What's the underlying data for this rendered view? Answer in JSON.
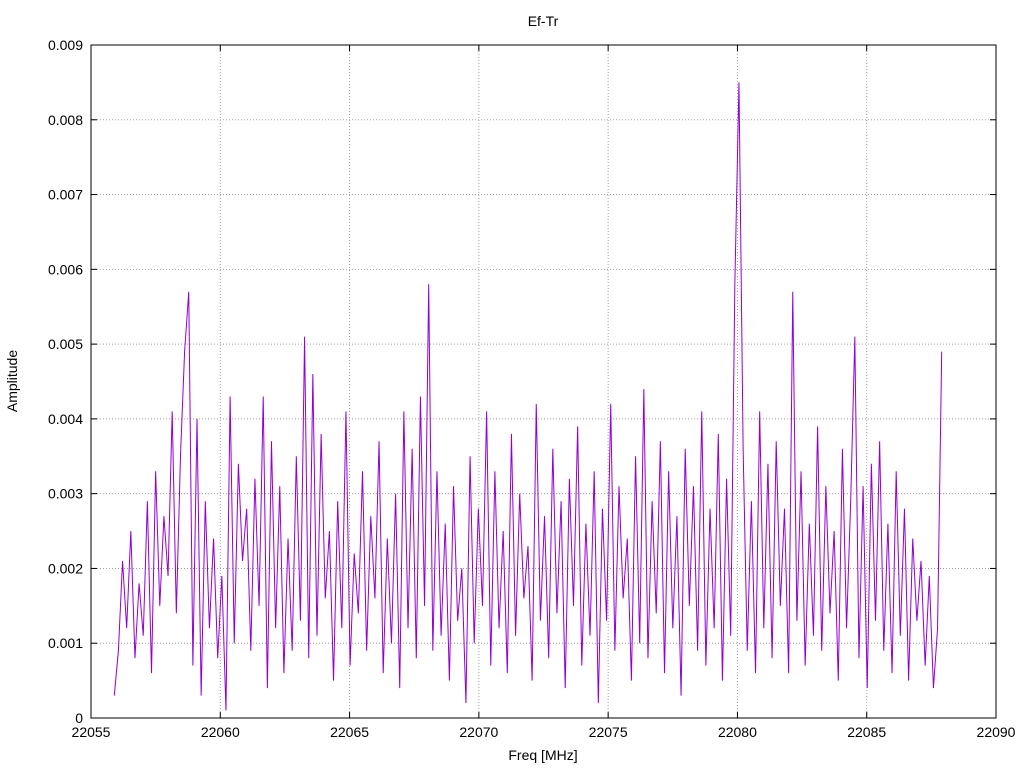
{
  "chart_data": {
    "type": "line",
    "title": "Ef-Tr",
    "xlabel": "Freq [MHz]",
    "ylabel": "Amplitude",
    "xlim": [
      22055,
      22090
    ],
    "ylim": [
      0,
      0.009
    ],
    "xticks": [
      "22055",
      "22060",
      "22065",
      "22070",
      "22075",
      "22080",
      "22085",
      "22090"
    ],
    "yticks": [
      "0",
      "0.001",
      "0.002",
      "0.003",
      "0.004",
      "0.005",
      "0.006",
      "0.007",
      "0.008",
      "0.009"
    ],
    "grid": true,
    "legend": "none",
    "series": [
      {
        "name": "Ef-Tr",
        "color": "#9400d3",
        "x_start": 22055.9,
        "x_step": 0.16,
        "values": [
          0.0003,
          0.0009,
          0.0021,
          0.0012,
          0.0025,
          0.0008,
          0.0018,
          0.0011,
          0.0029,
          0.0006,
          0.0033,
          0.0015,
          0.0027,
          0.0019,
          0.0041,
          0.0014,
          0.0035,
          0.0049,
          0.0057,
          0.0007,
          0.004,
          0.0003,
          0.0029,
          0.0012,
          0.0024,
          0.0008,
          0.0019,
          0.0001,
          0.0043,
          0.001,
          0.0034,
          0.0021,
          0.0028,
          0.0009,
          0.0032,
          0.0015,
          0.0043,
          0.0004,
          0.0037,
          0.0012,
          0.0031,
          0.0006,
          0.0024,
          0.0009,
          0.0035,
          0.0013,
          0.0051,
          0.0008,
          0.0046,
          0.0011,
          0.0038,
          0.0016,
          0.0025,
          0.0005,
          0.0029,
          0.0012,
          0.0041,
          0.0007,
          0.0022,
          0.0014,
          0.0033,
          0.0009,
          0.0027,
          0.0016,
          0.0037,
          0.0006,
          0.0024,
          0.001,
          0.003,
          0.0004,
          0.0041,
          0.0012,
          0.0036,
          0.0008,
          0.0043,
          0.0015,
          0.0058,
          0.0009,
          0.0033,
          0.0011,
          0.0026,
          0.0005,
          0.0031,
          0.0013,
          0.002,
          0.0002,
          0.0035,
          0.001,
          0.0028,
          0.0015,
          0.0041,
          0.0007,
          0.0033,
          0.0012,
          0.0025,
          0.0006,
          0.0038,
          0.0011,
          0.003,
          0.0016,
          0.0023,
          0.0005,
          0.0042,
          0.0013,
          0.0027,
          0.0008,
          0.0036,
          0.0014,
          0.0029,
          0.0004,
          0.0032,
          0.0015,
          0.0039,
          0.0007,
          0.0026,
          0.0011,
          0.0033,
          0.0002,
          0.0028,
          0.0013,
          0.0042,
          0.0009,
          0.0031,
          0.0016,
          0.0024,
          0.0005,
          0.0035,
          0.001,
          0.0044,
          0.0008,
          0.0029,
          0.0014,
          0.0037,
          0.0006,
          0.0033,
          0.0012,
          0.0027,
          0.0003,
          0.0036,
          0.0015,
          0.0031,
          0.0009,
          0.0041,
          0.0007,
          0.0028,
          0.0012,
          0.0038,
          0.0005,
          0.0032,
          0.0011,
          0.0058,
          0.0085,
          0.0036,
          0.0009,
          0.0029,
          0.0006,
          0.0041,
          0.0012,
          0.0034,
          0.0008,
          0.0037,
          0.0015,
          0.0028,
          0.0006,
          0.0057,
          0.0013,
          0.0033,
          0.0007,
          0.0026,
          0.0011,
          0.0039,
          0.0009,
          0.0031,
          0.0014,
          0.0025,
          0.0005,
          0.0036,
          0.0012,
          0.0029,
          0.0051,
          0.0008,
          0.0031,
          0.0004,
          0.0034,
          0.0013,
          0.0037,
          0.0009,
          0.0026,
          0.0006,
          0.0033,
          0.0011,
          0.0028,
          0.0005,
          0.0024,
          0.0013,
          0.0021,
          0.0007,
          0.0019,
          0.0004,
          0.0012,
          0.0049
        ]
      }
    ]
  }
}
